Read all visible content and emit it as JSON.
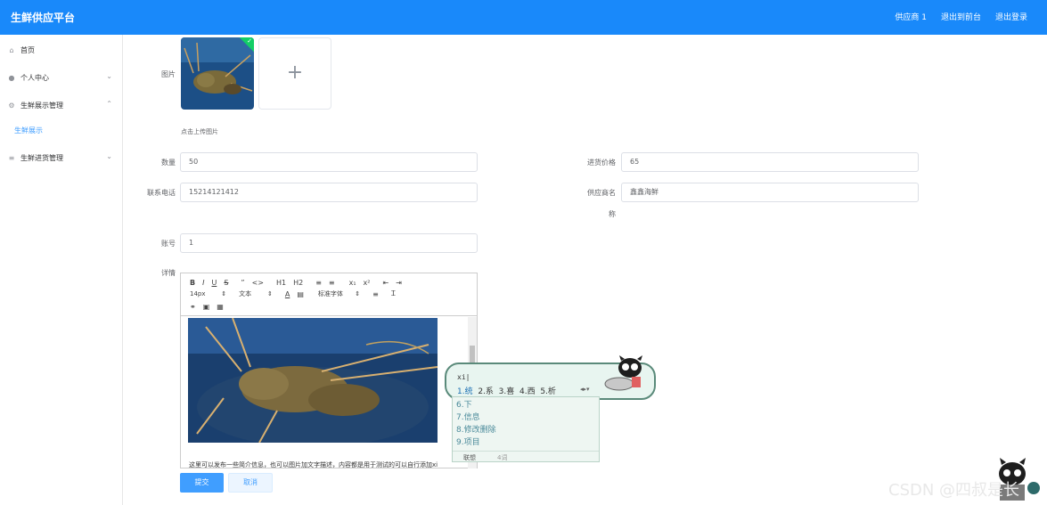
{
  "header": {
    "title": "生鲜供应平台",
    "nav": [
      "供应商 1",
      "退出到前台",
      "退出登录"
    ]
  },
  "sidebar": {
    "items": [
      {
        "label": "首页",
        "icon": "home-icon"
      },
      {
        "label": "个人中心",
        "icon": "user-icon"
      },
      {
        "label": "生鲜展示管理",
        "icon": "gear-icon"
      },
      {
        "label": "生鲜展示",
        "icon": ""
      },
      {
        "label": "生鲜进货管理",
        "icon": "menu-icon"
      }
    ]
  },
  "form": {
    "image_label": "图片",
    "upload_hint": "点击上传图片",
    "quantity_label": "数量",
    "quantity_value": "50",
    "purchase_price_label": "进货价格",
    "purchase_price_value": "65",
    "phone_label": "联系电话",
    "phone_value": "15214121412",
    "supplier_label": "供应商名",
    "supplier_label_tail": "称",
    "supplier_value": "鑫鑫海鲜",
    "account_label": "账号",
    "account_value": "1",
    "detail_label": "详情",
    "submit_label": "提交",
    "cancel_label": "取消"
  },
  "editor": {
    "toolbar_row1": [
      "B",
      "I",
      "U",
      "S",
      "”",
      "<>",
      "H1",
      "H2",
      "≡",
      "≡",
      "x₁",
      "x²",
      "⇤",
      "⇥"
    ],
    "font_size": "14px",
    "block_type": "文本",
    "font_family": "标准字体",
    "body_text": "这里可以发布一些简介信息，也可以图片加文字描述，内容都是用于测试的可以自行添加xi"
  },
  "ime": {
    "input": "xi|",
    "candidates_row": [
      "1.统",
      "2.系",
      "3.喜",
      "4.西",
      "5.析"
    ],
    "candidates_list": [
      "6.下",
      "7.信息",
      "8.修改删除",
      "9.项目"
    ],
    "footer": [
      "联想",
      "4词"
    ]
  },
  "watermark": "CSDN @四叔是长"
}
